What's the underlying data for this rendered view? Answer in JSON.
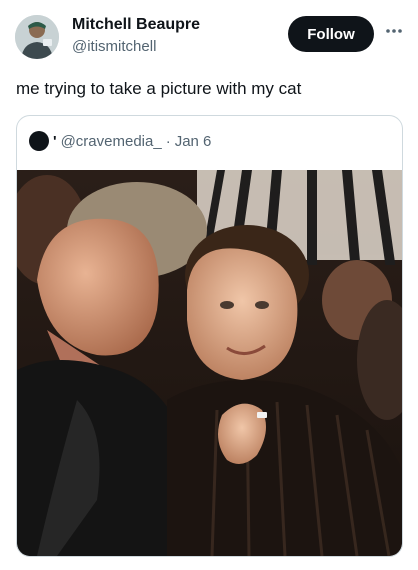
{
  "tweet": {
    "author": {
      "name": "Mitchell Beaupre",
      "handle": "@itismitchell",
      "avatar_icon": "profile-photo"
    },
    "follow_label": "Follow",
    "more_icon": "more-horizontal-icon",
    "text": "me trying to take a picture with my cat"
  },
  "quote": {
    "name": "'",
    "handle": "@cravemedia_",
    "separator": "·",
    "date": "Jan 6",
    "image_description_icon": "photo"
  },
  "colors": {
    "text_primary": "#0f1419",
    "text_secondary": "#536471",
    "border": "#cfd9de",
    "button_bg": "#0f1419"
  }
}
